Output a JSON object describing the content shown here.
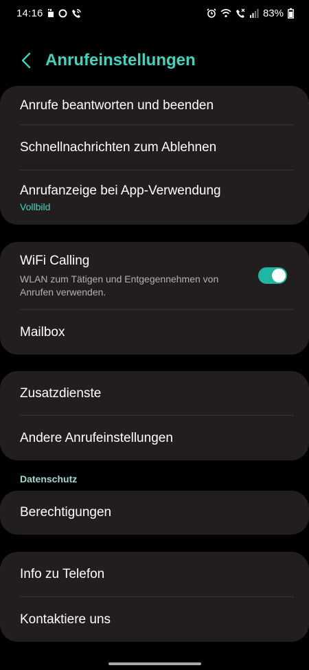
{
  "statusbar": {
    "time": "14:16",
    "battery": "83%",
    "icons_left": [
      "sim-card-icon",
      "circle-icon",
      "wifi-call-icon"
    ],
    "icons_right": [
      "alarm-icon",
      "wifi-icon",
      "volte-call-icon",
      "signal-icon",
      "battery-icon"
    ]
  },
  "header": {
    "title": "Anrufeinstellungen",
    "accent_color": "#3fd3c0"
  },
  "group1": {
    "answer_end": "Anrufe beantworten und beenden",
    "quick_decline": "Schnellnachrichten zum Ablehnen",
    "app_display_title": "Anrufanzeige bei App-Verwendung",
    "app_display_value": "Vollbild"
  },
  "group2": {
    "wifi_calling_title": "WiFi Calling",
    "wifi_calling_desc": "WLAN zum Tätigen und Entgegennehmen von Anrufen verwenden.",
    "wifi_calling_enabled": true,
    "mailbox": "Mailbox"
  },
  "group3": {
    "supplementary": "Zusatzdienste",
    "other_settings": "Andere Anrufeinstellungen"
  },
  "privacy": {
    "section_label": "Datenschutz",
    "permissions": "Berechtigungen"
  },
  "group4": {
    "about_phone": "Info zu Telefon",
    "contact_us": "Kontaktiere uns"
  }
}
